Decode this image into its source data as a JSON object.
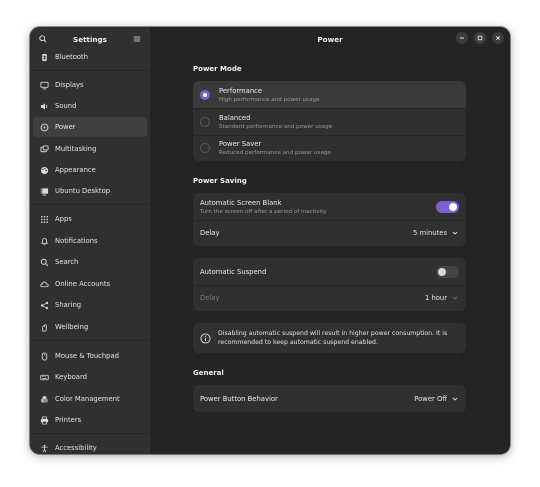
{
  "window": {
    "sidebar_title": "Settings",
    "main_title": "Power"
  },
  "sidebar": {
    "items": [
      {
        "label": "Bluetooth",
        "icon": "bluetooth-icon",
        "active": false
      },
      {
        "label": "Displays",
        "icon": "display-icon",
        "active": false
      },
      {
        "label": "Sound",
        "icon": "speaker-icon",
        "active": false
      },
      {
        "label": "Power",
        "icon": "power-icon",
        "active": true
      },
      {
        "label": "Multitasking",
        "icon": "multitasking-icon",
        "active": false
      },
      {
        "label": "Appearance",
        "icon": "palette-icon",
        "active": false
      },
      {
        "label": "Ubuntu Desktop",
        "icon": "ubuntu-desktop-icon",
        "active": false
      },
      {
        "label": "Apps",
        "icon": "apps-grid-icon",
        "active": false
      },
      {
        "label": "Notifications",
        "icon": "bell-icon",
        "active": false
      },
      {
        "label": "Search",
        "icon": "search-icon",
        "active": false
      },
      {
        "label": "Online Accounts",
        "icon": "cloud-icon",
        "active": false
      },
      {
        "label": "Sharing",
        "icon": "share-icon",
        "active": false
      },
      {
        "label": "Wellbeing",
        "icon": "wellbeing-icon",
        "active": false
      },
      {
        "label": "Mouse & Touchpad",
        "icon": "mouse-icon",
        "active": false
      },
      {
        "label": "Keyboard",
        "icon": "keyboard-icon",
        "active": false
      },
      {
        "label": "Color Management",
        "icon": "color-icon",
        "active": false
      },
      {
        "label": "Printers",
        "icon": "printer-icon",
        "active": false
      },
      {
        "label": "Accessibility",
        "icon": "accessibility-icon",
        "active": false
      }
    ]
  },
  "power_mode": {
    "heading": "Power Mode",
    "options": [
      {
        "title": "Performance",
        "subtitle": "High performance and power usage",
        "selected": true
      },
      {
        "title": "Balanced",
        "subtitle": "Standard performance and power usage",
        "selected": false
      },
      {
        "title": "Power Saver",
        "subtitle": "Reduced performance and power usage",
        "selected": false
      }
    ]
  },
  "power_saving": {
    "heading": "Power Saving",
    "screen_blank": {
      "title": "Automatic Screen Blank",
      "subtitle": "Turn the screen off after a period of inactivity",
      "enabled": true,
      "delay_label": "Delay",
      "delay_value": "5 minutes"
    },
    "suspend": {
      "title": "Automatic Suspend",
      "enabled": false,
      "delay_label": "Delay",
      "delay_value": "1 hour"
    },
    "info_text": "Disabling automatic suspend will result in higher power consumption. It is recommended to keep automatic suspend enabled."
  },
  "general": {
    "heading": "General",
    "button_behavior_label": "Power Button Behavior",
    "button_behavior_value": "Power Off"
  },
  "colors": {
    "accent": "#7c5fd6",
    "window_bg": "#242424",
    "sidebar_bg": "#303030",
    "card_bg": "#303030"
  }
}
